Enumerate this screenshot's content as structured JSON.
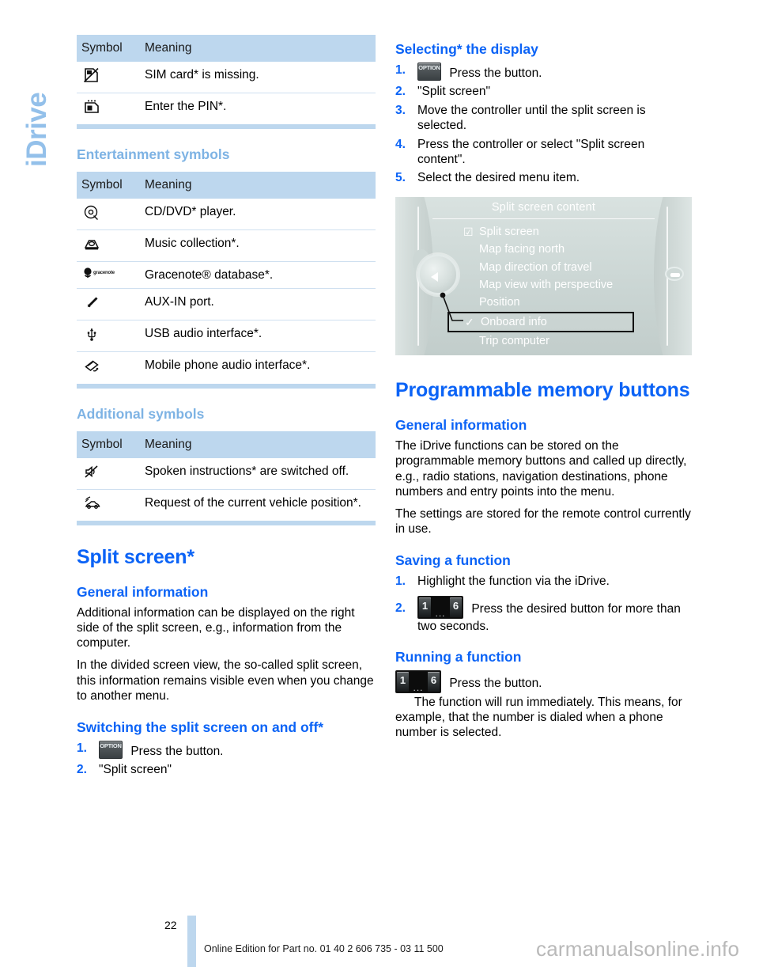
{
  "chapter_tab": {
    "label": "iDrive"
  },
  "left_column": {
    "table_phone": {
      "headers": [
        "Symbol",
        "Meaning"
      ],
      "rows": [
        {
          "icon": "sim-card-missing-icon",
          "meaning": "SIM card* is missing."
        },
        {
          "icon": "enter-pin-icon",
          "meaning": "Enter the PIN*."
        }
      ]
    },
    "entertainment_heading": "Entertainment symbols",
    "table_entertainment": {
      "headers": [
        "Symbol",
        "Meaning"
      ],
      "rows": [
        {
          "icon": "cd-dvd-icon",
          "meaning": "CD/DVD* player."
        },
        {
          "icon": "music-collection-icon",
          "meaning": "Music collection*."
        },
        {
          "icon": "gracenote-icon",
          "icon_text": "gracenote",
          "meaning": "Gracenote® database*."
        },
        {
          "icon": "aux-in-icon",
          "meaning": "AUX-IN port."
        },
        {
          "icon": "usb-icon",
          "meaning": "USB audio interface*."
        },
        {
          "icon": "mobile-phone-audio-icon",
          "meaning": "Mobile phone audio interface*."
        }
      ]
    },
    "additional_heading": "Additional symbols",
    "table_additional": {
      "headers": [
        "Symbol",
        "Meaning"
      ],
      "rows": [
        {
          "icon": "speaker-muted-icon",
          "meaning": "Spoken instructions* are switched off."
        },
        {
          "icon": "vehicle-position-icon",
          "meaning": "Request of the current vehicle position*."
        }
      ]
    },
    "split_screen_title": "Split screen*",
    "general_information_heading": "General information",
    "general_paragraph_1": "Additional information can be displayed on the right side of the split screen, e.g., information from the computer.",
    "general_paragraph_2": "In the divided screen view, the so-called split screen, this information remains visible even when you change to another menu.",
    "switching_heading": "Switching the split screen on and off*",
    "switching_steps": [
      {
        "num": "1.",
        "button": "OPTION",
        "text": "Press the button."
      },
      {
        "num": "2.",
        "text": "\"Split screen\""
      }
    ]
  },
  "right_column": {
    "selecting_heading": "Selecting* the display",
    "selecting_steps": [
      {
        "num": "1.",
        "button": "OPTION",
        "text": "Press the button."
      },
      {
        "num": "2.",
        "text": "\"Split screen\""
      },
      {
        "num": "3.",
        "text": "Move the controller until the split screen is selected."
      },
      {
        "num": "4.",
        "text": "Press the controller or select \"Split screen content\"."
      },
      {
        "num": "5.",
        "text": "Select the desired menu item."
      }
    ],
    "figure": {
      "title": "Split screen content",
      "items": [
        {
          "label": "Split screen",
          "mark": "☑",
          "selected": false
        },
        {
          "label": "Map facing north",
          "mark": "",
          "selected": false
        },
        {
          "label": "Map direction of travel",
          "mark": "",
          "selected": false
        },
        {
          "label": "Map view with perspective",
          "mark": "",
          "selected": false
        },
        {
          "label": "Position",
          "mark": "",
          "selected": false
        },
        {
          "label": "Onboard info",
          "mark": "✓",
          "selected": true
        },
        {
          "label": "Trip computer",
          "mark": "",
          "selected": false
        }
      ]
    },
    "memory_title": "Programmable memory buttons",
    "memory_general_heading": "General information",
    "memory_paragraph_1": "The iDrive functions can be stored on the programmable memory buttons and called up directly, e.g., radio stations, navigation destinations, phone numbers and entry points into the menu.",
    "memory_paragraph_2": "The settings are stored for the remote control currently in use.",
    "saving_heading": "Saving a function",
    "saving_steps": [
      {
        "num": "1.",
        "text": "Highlight the function via the iDrive."
      },
      {
        "num": "2.",
        "button": "memory",
        "text": "Press the desired button for more than two seconds."
      }
    ],
    "running_heading": "Running a function",
    "running_button_text": "Press the button.",
    "running_paragraph": "The function will run immediately. This means, for example, that the number is dialed when a phone number is selected."
  },
  "memory_button": {
    "first": "1",
    "dots": "...",
    "last": "6"
  },
  "option_button": {
    "cap": "OPTION"
  },
  "footer": {
    "page_number": "22",
    "edition_text": "Online Edition for Part no. 01 40 2 606 735 - 03 11 500",
    "watermark": "carmanualsonline.info"
  },
  "colors": {
    "heading_blue": "#0b63f6",
    "light_blue": "#7eb3e4",
    "table_header_bg": "#bdd7ee",
    "tab_blue": "#93c0ea"
  }
}
